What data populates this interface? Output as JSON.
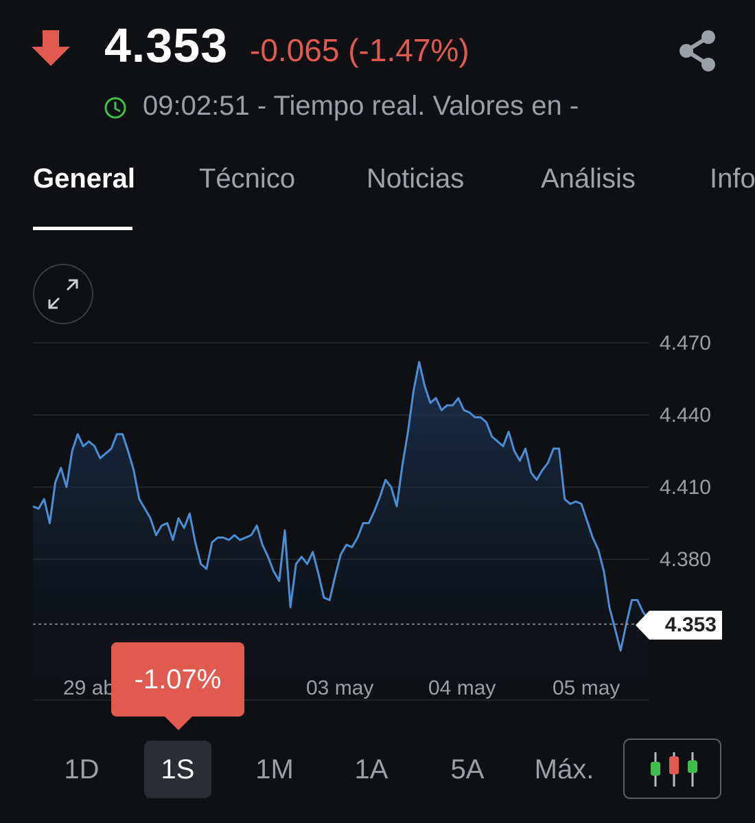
{
  "header": {
    "price": "4.353",
    "change": "-0.065 (-1.47%)",
    "realtime_text": "09:02:51 - Tiempo real. Valores en -",
    "icons": [
      "down-arrow-icon",
      "share-icon",
      "clock-icon"
    ],
    "colors": {
      "negative": "#e05a4f",
      "live": "#3fbf4a",
      "line": "#4a8fd6"
    }
  },
  "tabs": [
    {
      "label": "General",
      "active": true
    },
    {
      "label": "Técnico"
    },
    {
      "label": "Noticias"
    },
    {
      "label": "Análisis"
    },
    {
      "label": "Info"
    }
  ],
  "chart": {
    "current_price_label": "4.353",
    "tooltip": "-1.07%",
    "expand_icon": "expand-icon"
  },
  "ranges": [
    {
      "label": "1D"
    },
    {
      "label": "1S",
      "active": true
    },
    {
      "label": "1M"
    },
    {
      "label": "1A"
    },
    {
      "label": "5A"
    },
    {
      "label": "Máx."
    }
  ],
  "chart_type_button_icon": "candlestick-icon",
  "chart_data": {
    "type": "area",
    "y_ticks": [
      "4.470",
      "4.440",
      "4.410",
      "4.380"
    ],
    "x_ticks": [
      "29 ab",
      "03 may",
      "04 may",
      "05 may"
    ],
    "ylim": [
      4.35,
      4.47
    ],
    "grid": true,
    "current_value": 4.353,
    "series": [
      {
        "values": [
          4.402,
          4.401,
          4.405,
          4.395,
          4.412,
          4.418,
          4.41,
          4.425,
          4.432,
          4.427,
          4.429,
          4.427,
          4.422,
          4.424,
          4.426,
          4.432,
          4.432,
          4.425,
          4.417,
          4.405,
          4.401,
          4.397,
          4.39,
          4.394,
          4.395,
          4.388,
          4.397,
          4.393,
          4.399,
          4.387,
          4.378,
          4.376,
          4.387,
          4.389,
          4.389,
          4.388,
          4.39,
          4.388,
          4.389,
          4.39,
          4.394,
          4.386,
          4.381,
          4.375,
          4.371,
          4.392,
          4.36,
          4.378,
          4.381,
          4.378,
          4.383,
          4.374,
          4.364,
          4.363,
          4.373,
          4.382,
          4.386,
          4.385,
          4.389,
          4.395,
          4.395,
          4.4,
          4.406,
          4.413,
          4.41,
          4.402,
          4.419,
          4.433,
          4.45,
          4.462,
          4.452,
          4.445,
          4.447,
          4.442,
          4.444,
          4.444,
          4.447,
          4.442,
          4.441,
          4.439,
          4.439,
          4.437,
          4.431,
          4.429,
          4.427,
          4.433,
          4.425,
          4.421,
          4.426,
          4.416,
          4.413,
          4.417,
          4.42,
          4.426,
          4.426,
          4.405,
          4.403,
          4.404,
          4.403,
          4.396,
          4.389,
          4.384,
          4.375,
          4.36,
          4.351,
          4.342,
          4.353,
          4.363,
          4.363,
          4.358,
          4.355
        ]
      }
    ]
  }
}
